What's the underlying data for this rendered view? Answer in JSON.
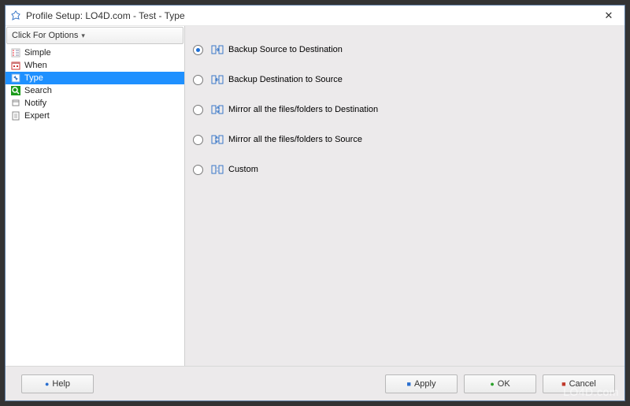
{
  "titlebar": {
    "title": "Profile Setup: LO4D.com - Test - Type",
    "close": "✕"
  },
  "sidebar": {
    "options_label": "Click For Options",
    "items": [
      {
        "label": "Simple"
      },
      {
        "label": "When"
      },
      {
        "label": "Type"
      },
      {
        "label": "Search"
      },
      {
        "label": "Notify"
      },
      {
        "label": "Expert"
      }
    ]
  },
  "main": {
    "options": [
      {
        "label": "Backup Source to Destination"
      },
      {
        "label": "Backup Destination to Source"
      },
      {
        "label": "Mirror all the files/folders to Destination"
      },
      {
        "label": "Mirror all the files/folders to Source"
      },
      {
        "label": "Custom"
      }
    ]
  },
  "footer": {
    "help": "Help",
    "apply": "Apply",
    "ok": "OK",
    "cancel": "Cancel"
  },
  "watermark": "LO4D.com"
}
